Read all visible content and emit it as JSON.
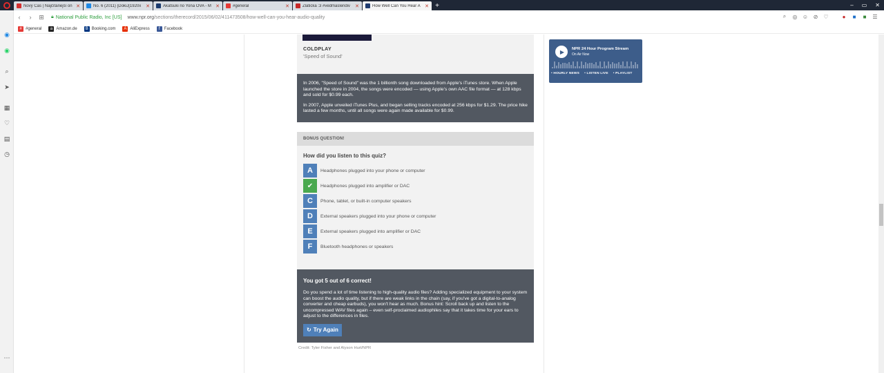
{
  "tabs": [
    {
      "title": "Nový Čas | Najčítanejší on",
      "fav_color": "#d32f2f",
      "active": false
    },
    {
      "title": "No. 6 (2011) [DokiJ[1920x",
      "fav_color": "#1e88e5",
      "active": false
    },
    {
      "title": "Akatsuki no Yona OVA - M",
      "fav_color": "#1a3a6e",
      "active": false
    },
    {
      "title": "#general",
      "fav_color": "#e53935",
      "active": false
    },
    {
      "title": "Zlaticka :3 #vedmaslendiv",
      "fav_color": "#c62828",
      "active": false
    },
    {
      "title": "How Well Can You Hear A",
      "fav_color": "#1f3b70",
      "active": true
    }
  ],
  "address": {
    "site_identity": "National Public Radio, Inc [US]",
    "url_domain": "www.npr.org",
    "url_path": "/sections/therecord/2015/06/02/411473508/how-well-can-you-hear-audio-quality"
  },
  "bookmarks": [
    {
      "label": "#general",
      "color": "#e53935",
      "glyph": "#"
    },
    {
      "label": "Amazon.de",
      "color": "#222222",
      "glyph": "a"
    },
    {
      "label": "Booking.com",
      "color": "#003580",
      "glyph": "B"
    },
    {
      "label": "AliExpress",
      "color": "#e62e04",
      "glyph": "A"
    },
    {
      "label": "Facebook",
      "color": "#3b5998",
      "glyph": "f"
    }
  ],
  "song": {
    "artist": "COLDPLAY",
    "title": "'Speed of Sound'"
  },
  "info": {
    "p1": "In 2006, \"Speed of Sound\" was the 1 billionth song downloaded from Apple's iTunes store. When Apple launched the store in 2004, the songs were encoded — using Apple's own AAC file format — at 128 kbps and sold for $0.99 each.",
    "p2": "In 2007, Apple unveiled iTunes Plus, and began selling tracks encoded at 256 kbps for $1.29. The price hike lasted a few months, until all songs were again made available for $0.99."
  },
  "bonus": {
    "heading": "BONUS QUESTION!",
    "question": "How did you listen to this quiz?",
    "options": [
      {
        "letter": "A",
        "text": "Headphones plugged into your phone or computer",
        "selected": false
      },
      {
        "letter": "✔",
        "text": "Headphones plugged into amplifier or DAC",
        "selected": true
      },
      {
        "letter": "C",
        "text": "Phone, tablet, or built-in computer speakers",
        "selected": false
      },
      {
        "letter": "D",
        "text": "External speakers plugged into your phone or computer",
        "selected": false
      },
      {
        "letter": "E",
        "text": "External speakers plugged into amplifier or DAC",
        "selected": false
      },
      {
        "letter": "F",
        "text": "Bluetooth headphones or speakers",
        "selected": false
      }
    ]
  },
  "result": {
    "heading": "You got 5 out of 6 correct!",
    "body": "Do you spend a lot of time listening to high-quality audio files? Adding specialized equipment to your system can boost the audio quality, but if there are weak links in the chain (say, if you've got a digital-to-analog converter and cheap earbuds), you won't hear as much. Bonus hint: Scroll back up and listen to the uncompressed WAV files again – even self-proclaimed audiophiles say that it takes time for your ears to adjust to the differences in files.",
    "button": "Try Again"
  },
  "credit": "Credit: Tyler Fisher and Alyson Hurt/NPR",
  "player": {
    "title": "NPR 24 Hour Program Stream",
    "subtitle": "On Air Now",
    "links": [
      "• HOURLY NEWS",
      "• LISTEN LIVE",
      "• PLAYLIST"
    ]
  }
}
